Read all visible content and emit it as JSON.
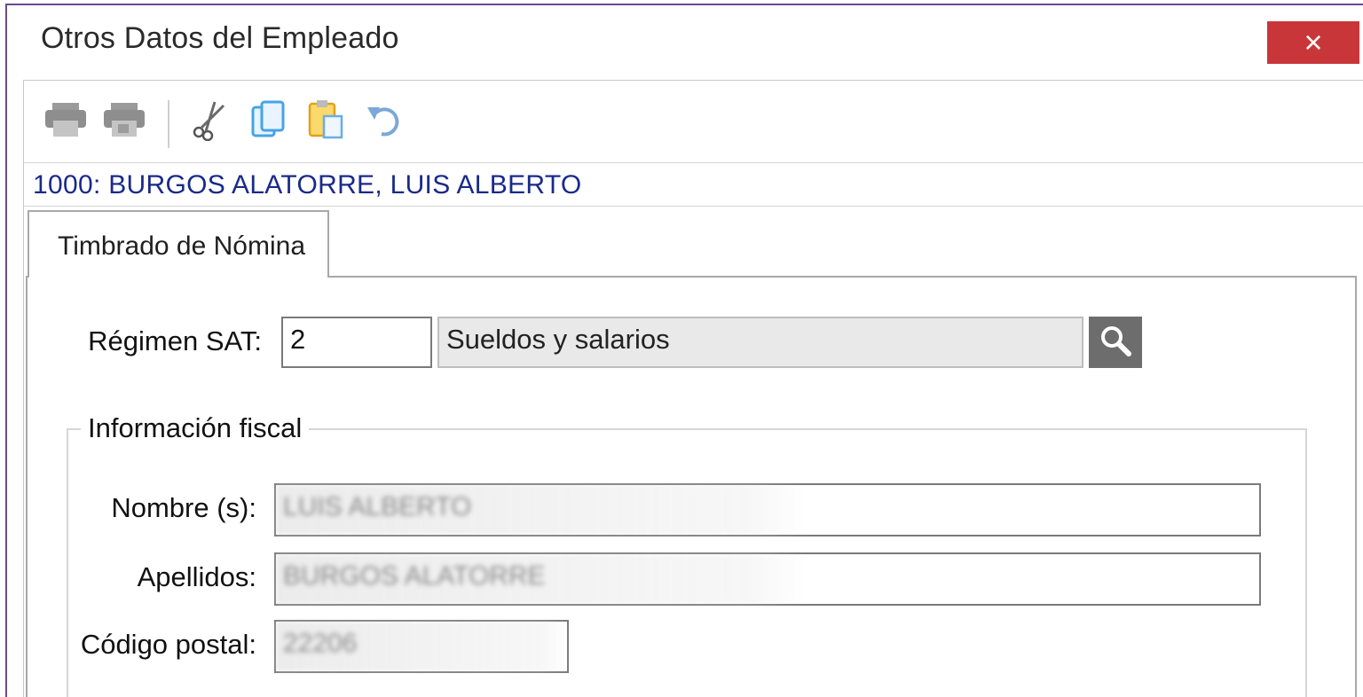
{
  "window": {
    "title": "Otros Datos del Empleado",
    "close_label": "×"
  },
  "toolbar": {
    "buttons": [
      {
        "name": "print-icon"
      },
      {
        "name": "print-preview-icon"
      },
      {
        "name": "cut-icon"
      },
      {
        "name": "copy-icon"
      },
      {
        "name": "paste-icon"
      },
      {
        "name": "undo-icon"
      }
    ]
  },
  "employee": {
    "header": "1000: BURGOS ALATORRE, LUIS ALBERTO"
  },
  "tabs": [
    {
      "label": "Timbrado de Nómina",
      "active": true
    }
  ],
  "regimen": {
    "label": "Régimen SAT:",
    "code": "2",
    "description": "Sueldos y salarios"
  },
  "fiscal": {
    "group_title": "Información fiscal",
    "nombre_label": "Nombre (s):",
    "nombre_value": "LUIS ALBERTO",
    "apellidos_label": "Apellidos:",
    "apellidos_value": "BURGOS ALATORRE",
    "cp_label": "Código postal:",
    "cp_value": "22206"
  },
  "colors": {
    "close": "#c9363a",
    "header_text": "#1a2a8a",
    "frame": "#6b4a8f"
  }
}
